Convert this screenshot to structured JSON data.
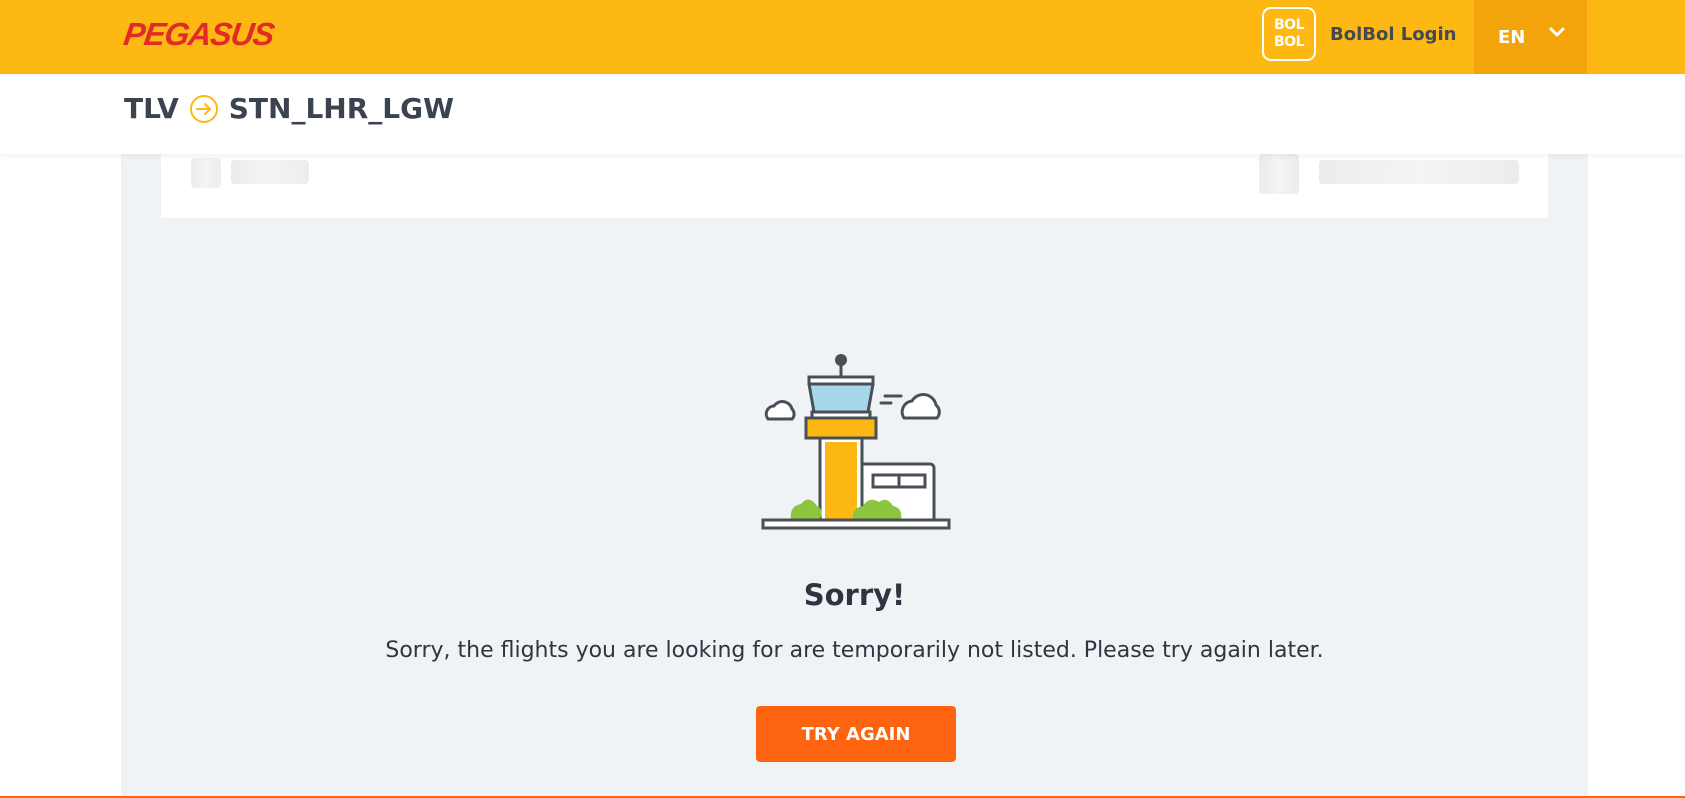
{
  "header": {
    "logo_text": "PEGASUS",
    "bolbol_badge_top": "BOL",
    "bolbol_badge_bottom": "BOL",
    "bolbol_login_label": "BolBol Login",
    "language_code": "EN"
  },
  "route": {
    "origin": "TLV",
    "destination": "STN_LHR_LGW",
    "arrow_icon": "circle-arrow-right-icon"
  },
  "message": {
    "title": "Sorry!",
    "text": "Sorry, the flights you are looking for are temporarily not listed. Please try again later.",
    "illustration": "control-tower-illustration",
    "button_label": "TRY AGAIN"
  },
  "colors": {
    "header_yellow": "#fdb813",
    "language_bg": "#f3a40a",
    "logo_red": "#e22a26",
    "button_orange": "#fe6310",
    "content_bg": "#f0f3f6"
  }
}
